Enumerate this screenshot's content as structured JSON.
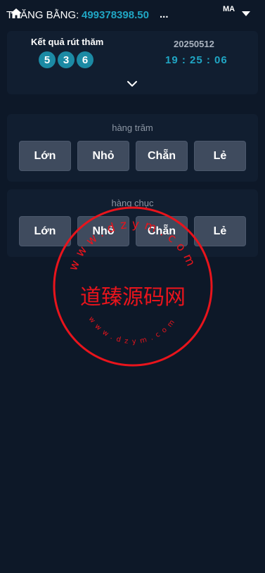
{
  "header": {
    "balance_label": "THĂNG BẰNG:",
    "balance_value": "499378398.50",
    "balance_ellipsis": "...",
    "user_code": "MA"
  },
  "result": {
    "title": "Kết quả rút thăm",
    "balls": [
      "5",
      "3",
      "6"
    ],
    "period": "20250512",
    "countdown": "19 : 25 : 06"
  },
  "panels": [
    {
      "title": "hàng trăm",
      "buttons": [
        "Lớn",
        "Nhỏ",
        "Chẵn",
        "Lẻ"
      ]
    },
    {
      "title": "hàng chục",
      "buttons": [
        "Lớn",
        "Nhỏ",
        "Chẵn",
        "Lẻ"
      ]
    }
  ],
  "watermark": {
    "center_text": "道臻源码网",
    "ring_top": "www.dzym.com",
    "ring_bottom": "www.dzym.com"
  },
  "colors": {
    "background": "#0d1828",
    "card": "#111e30",
    "accent": "#20a6c4",
    "button": "#3f4b5e",
    "watermark": "#e8141c"
  },
  "icons": {
    "home": "home-icon",
    "caret": "caret-down-icon",
    "chevron": "chevron-down-icon"
  }
}
